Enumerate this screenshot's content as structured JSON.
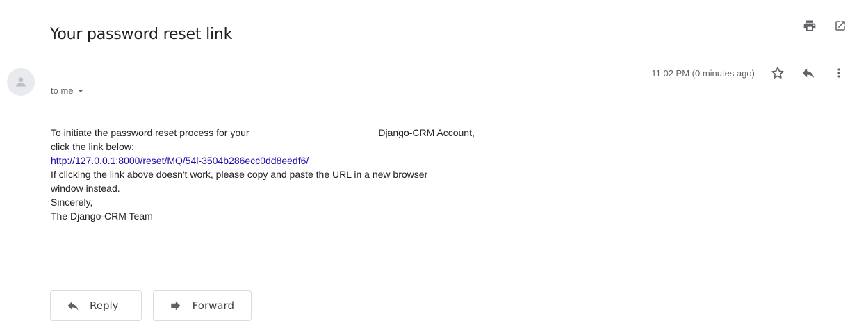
{
  "email": {
    "subject": "Your password reset link",
    "recipient_label": "to me",
    "timestamp": "11:02 PM (0 minutes ago)",
    "body": {
      "line1_prefix": "To initiate the password reset process for your",
      "line1_redacted": "",
      "line1_suffix": "Django-CRM Account,",
      "line2": "click the link below:",
      "reset_link": "http://127.0.0.1:8000/reset/MQ/54l-3504b286ecc0dd8eedf6/",
      "line4": "If clicking the link above doesn't work, please copy and paste the URL in a new browser",
      "line5": "window instead.",
      "line6": "Sincerely,",
      "line7": "The Django-CRM Team"
    }
  },
  "actions": {
    "reply_label": "Reply",
    "forward_label": "Forward"
  },
  "icons": {
    "print": "print-icon",
    "open_new_window": "open-in-new-icon",
    "star": "star-icon",
    "reply": "reply-icon",
    "more": "more-vert-icon",
    "avatar": "person-icon",
    "dropdown": "caret-down-icon",
    "forward": "forward-icon"
  },
  "colors": {
    "link": "#1a0dab",
    "icon": "#5f6368",
    "border": "#dadce0"
  }
}
